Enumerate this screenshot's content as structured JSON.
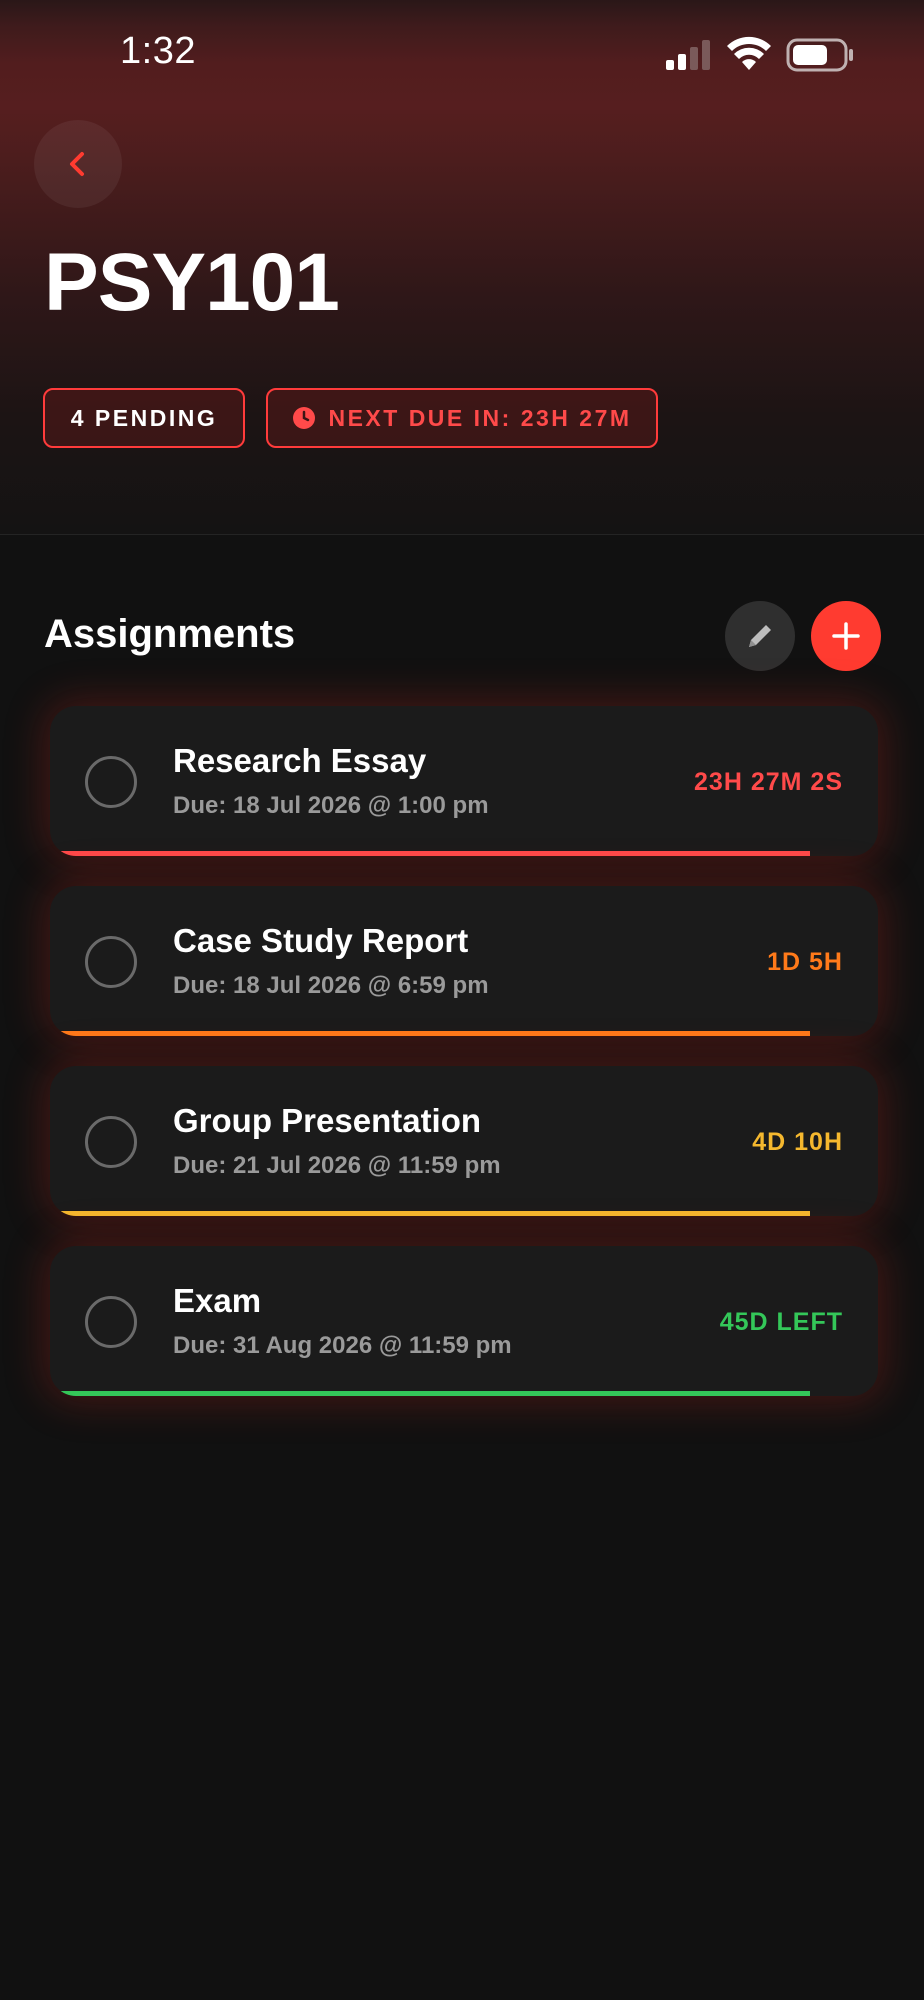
{
  "status_bar": {
    "time": "1:32",
    "icons": [
      "signal-icon",
      "wifi-icon",
      "battery-icon"
    ]
  },
  "header": {
    "back_icon": "chevron-left-icon",
    "title": "PSY101",
    "pending_badge": "4 PENDING",
    "next_due_badge": "NEXT DUE IN: 23H 27M",
    "next_due_icon": "clock-icon"
  },
  "section": {
    "title": "Assignments",
    "edit_icon": "pencil-icon",
    "add_icon": "plus-icon"
  },
  "colors": {
    "accent": "#ff3b30",
    "red": "#ff4a4a",
    "orange": "#ff7a1a",
    "yellow": "#f5b82e",
    "green": "#34c759"
  },
  "assignments": [
    {
      "title": "Research Essay",
      "due": "Due: 18 Jul 2026 @ 1:00 pm",
      "remaining": "23H 27M 2S",
      "color": "#ff4a4a"
    },
    {
      "title": "Case Study Report",
      "due": "Due: 18 Jul 2026 @ 6:59 pm",
      "remaining": "1D 5H",
      "color": "#ff7a1a"
    },
    {
      "title": "Group Presentation",
      "due": "Due: 21 Jul 2026 @ 11:59 pm",
      "remaining": "4D 10H",
      "color": "#f5b82e"
    },
    {
      "title": "Exam",
      "due": "Due: 31 Aug 2026 @ 11:59 pm",
      "remaining": "45D LEFT",
      "color": "#34c759"
    }
  ]
}
